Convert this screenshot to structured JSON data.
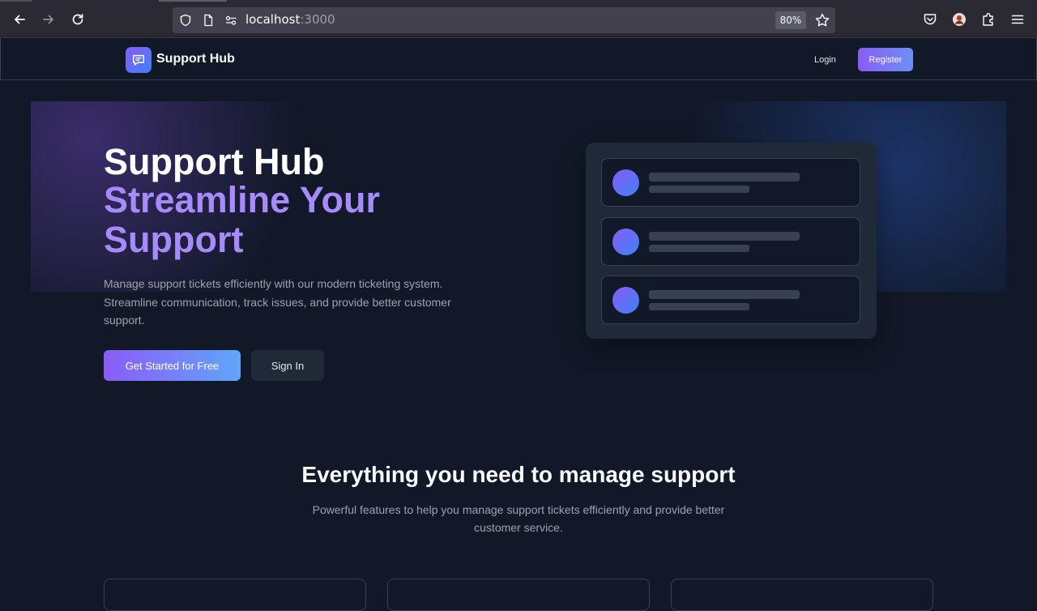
{
  "browser": {
    "url_host": "localhost",
    "url_port": ":3000",
    "zoom": "80%"
  },
  "nav": {
    "brand": "Support Hub",
    "login": "Login",
    "register": "Register"
  },
  "hero": {
    "title_line1": "Support Hub",
    "title_line2": "Streamline Your Support",
    "description": "Manage support tickets efficiently with our modern ticketing system. Streamline communication, track issues, and provide better customer support.",
    "primary_cta": "Get Started for Free",
    "secondary_cta": "Sign In"
  },
  "features": {
    "title": "Everything you need to manage support",
    "description": "Powerful features to help you manage support tickets efficiently and provide better customer service."
  },
  "colors": {
    "background": "#111827",
    "accent_purple": "#8b5cf6",
    "accent_blue": "#60a5fa",
    "heading_purple": "#a78bfa"
  },
  "icons": {
    "logo": "chat-bubble-icon",
    "back": "back-arrow-icon",
    "forward": "forward-arrow-icon",
    "reload": "reload-icon",
    "shield": "shield-icon",
    "page": "page-icon",
    "permissions": "permissions-icon",
    "bookmark": "star-icon",
    "pocket": "pocket-icon",
    "account": "account-icon",
    "extensions": "extensions-icon",
    "menu": "hamburger-menu-icon"
  }
}
